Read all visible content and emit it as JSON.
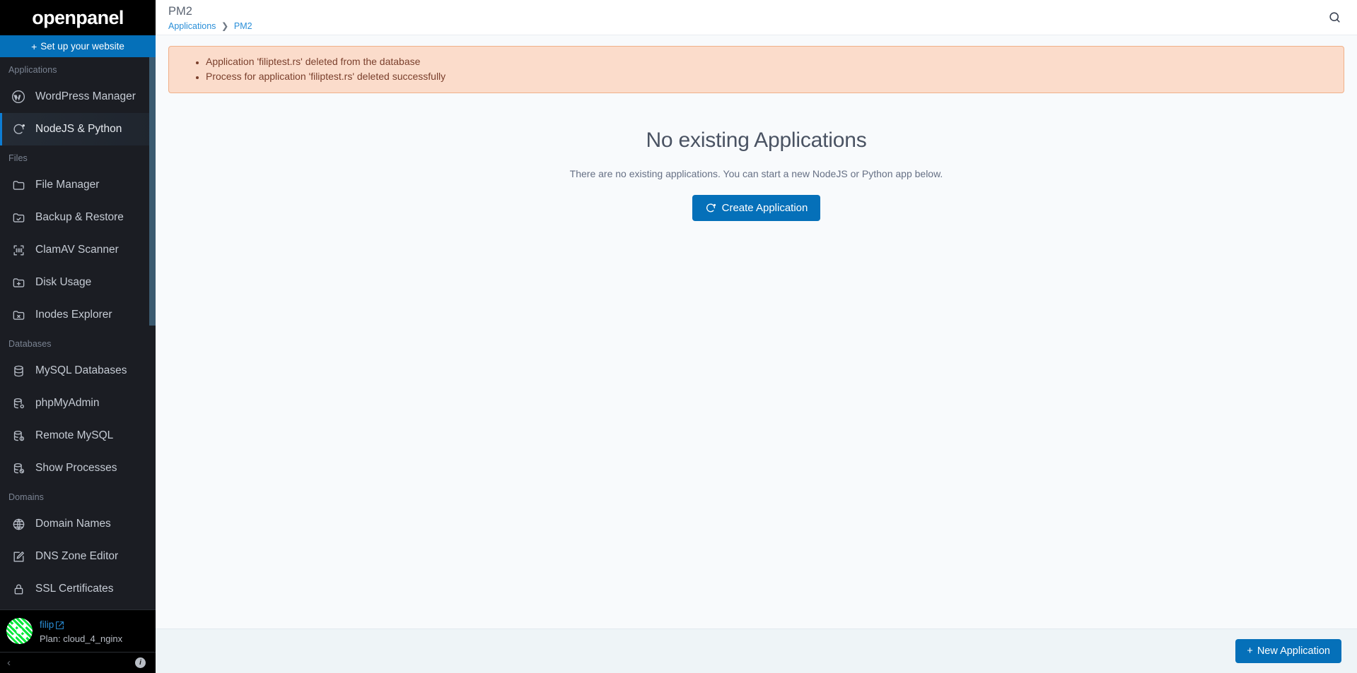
{
  "brand": {
    "name": "openpanel"
  },
  "setup": {
    "label": "Set up your website",
    "plus": "+"
  },
  "sidebar": {
    "sections": [
      {
        "title": "Applications",
        "items": [
          {
            "label": "WordPress Manager",
            "icon": "wordpress-icon",
            "active": false
          },
          {
            "label": "NodeJS & Python",
            "icon": "nodejs-icon",
            "active": true
          }
        ]
      },
      {
        "title": "Files",
        "items": [
          {
            "label": "File Manager",
            "icon": "folder-icon",
            "active": false
          },
          {
            "label": "Backup & Restore",
            "icon": "folder-check-icon",
            "active": false
          },
          {
            "label": "ClamAV Scanner",
            "icon": "scan-icon",
            "active": false
          },
          {
            "label": "Disk Usage",
            "icon": "folder-plus-icon",
            "active": false
          },
          {
            "label": "Inodes Explorer",
            "icon": "folder-x-icon",
            "active": false
          }
        ]
      },
      {
        "title": "Databases",
        "items": [
          {
            "label": "MySQL Databases",
            "icon": "database-icon",
            "active": false
          },
          {
            "label": "phpMyAdmin",
            "icon": "database-cog-icon",
            "active": false
          },
          {
            "label": "Remote MySQL",
            "icon": "database-alert-icon",
            "active": false
          },
          {
            "label": "Show Processes",
            "icon": "database-ban-icon",
            "active": false
          }
        ]
      },
      {
        "title": "Domains",
        "items": [
          {
            "label": "Domain Names",
            "icon": "globe-icon",
            "active": false
          },
          {
            "label": "DNS Zone Editor",
            "icon": "edit-square-icon",
            "active": false
          },
          {
            "label": "SSL Certificates",
            "icon": "lock-icon",
            "active": false
          }
        ]
      }
    ]
  },
  "user": {
    "name": "filip",
    "plan": "Plan: cloud_4_nginx",
    "collapse_glyph": "‹",
    "info_glyph": "i"
  },
  "header": {
    "title": "PM2",
    "breadcrumb": {
      "parent": "Applications",
      "separator": "❯",
      "current": "PM2"
    },
    "search_icon": "search-icon"
  },
  "alert": {
    "messages": [
      "Application 'filiptest.rs' deleted from the database",
      "Process for application 'filiptest.rs' deleted successfully"
    ]
  },
  "empty_state": {
    "title": "No existing Applications",
    "subtitle": "There are no existing applications. You can start a new NodeJS or Python app below.",
    "create_label": "Create Application"
  },
  "bottombar": {
    "new_app_label": "New Application",
    "plus": "+"
  },
  "colors": {
    "accent": "#0570b9",
    "sidebar_bg": "#1b1d23",
    "brand_bg": "#000000",
    "alert_bg": "#fbdccb",
    "alert_border": "#f0b089",
    "alert_text": "#7a3f2c",
    "content_bg": "#f8fafc",
    "bottombar_bg": "#eef4f7",
    "link": "#2a8fd8",
    "avatar": "#00e83a"
  }
}
